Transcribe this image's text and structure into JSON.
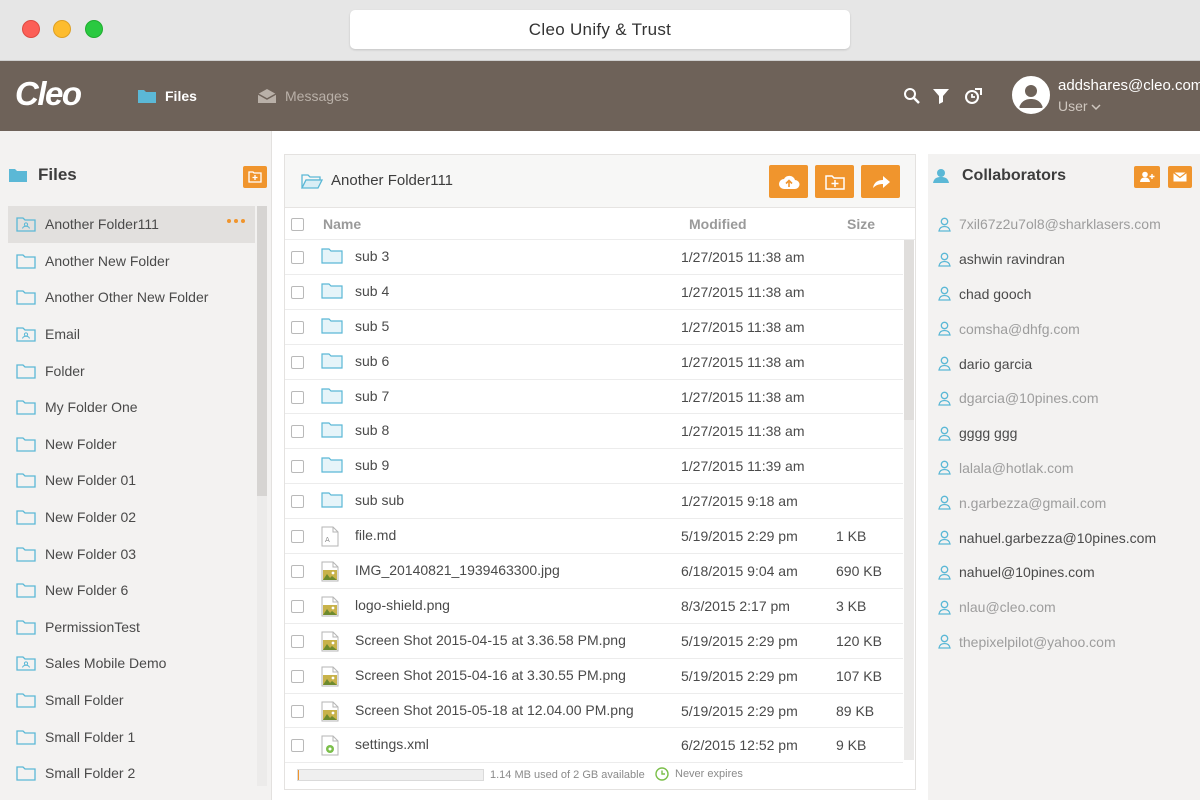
{
  "window": {
    "title": "Cleo Unify & Trust"
  },
  "header": {
    "logo": "Cleo",
    "nav": {
      "files": "Files",
      "messages": "Messages"
    },
    "user": {
      "email": "addshares@cleo.com",
      "role": "User"
    }
  },
  "sidebar": {
    "title": "Files",
    "folders": [
      {
        "label": "Another Folder111",
        "active": true,
        "shared": true
      },
      {
        "label": "Another New Folder"
      },
      {
        "label": "Another Other New Folder"
      },
      {
        "label": "Email",
        "shared": true
      },
      {
        "label": "Folder"
      },
      {
        "label": "My Folder One"
      },
      {
        "label": "New Folder"
      },
      {
        "label": "New Folder 01"
      },
      {
        "label": "New Folder 02"
      },
      {
        "label": "New Folder 03"
      },
      {
        "label": "New Folder 6"
      },
      {
        "label": "PermissionTest"
      },
      {
        "label": "Sales Mobile Demo",
        "shared": true
      },
      {
        "label": "Small Folder"
      },
      {
        "label": "Small Folder 1"
      },
      {
        "label": "Small Folder 2"
      }
    ]
  },
  "main": {
    "breadcrumb": "Another Folder111",
    "columns": {
      "name": "Name",
      "modified": "Modified",
      "size": "Size"
    },
    "files": [
      {
        "name": "sub 3",
        "modified": "1/27/2015 11:38 am",
        "size": "",
        "type": "folder"
      },
      {
        "name": "sub 4",
        "modified": "1/27/2015 11:38 am",
        "size": "",
        "type": "folder"
      },
      {
        "name": "sub 5",
        "modified": "1/27/2015 11:38 am",
        "size": "",
        "type": "folder"
      },
      {
        "name": "sub 6",
        "modified": "1/27/2015 11:38 am",
        "size": "",
        "type": "folder"
      },
      {
        "name": "sub 7",
        "modified": "1/27/2015 11:38 am",
        "size": "",
        "type": "folder"
      },
      {
        "name": "sub 8",
        "modified": "1/27/2015 11:38 am",
        "size": "",
        "type": "folder"
      },
      {
        "name": "sub 9",
        "modified": "1/27/2015 11:39 am",
        "size": "",
        "type": "folder"
      },
      {
        "name": "sub sub",
        "modified": "1/27/2015 9:18 am",
        "size": "",
        "type": "folder"
      },
      {
        "name": "file.md",
        "modified": "5/19/2015 2:29 pm",
        "size": "1 KB",
        "type": "doc"
      },
      {
        "name": "IMG_20140821_1939463300.jpg",
        "modified": "6/18/2015 9:04 am",
        "size": "690 KB",
        "type": "image"
      },
      {
        "name": "logo-shield.png",
        "modified": "8/3/2015 2:17 pm",
        "size": "3 KB",
        "type": "image"
      },
      {
        "name": "Screen Shot 2015-04-15 at 3.36.58 PM.png",
        "modified": "5/19/2015 2:29 pm",
        "size": "120 KB",
        "type": "image"
      },
      {
        "name": "Screen Shot 2015-04-16 at 3.30.55 PM.png",
        "modified": "5/19/2015 2:29 pm",
        "size": "107 KB",
        "type": "image"
      },
      {
        "name": "Screen Shot 2015-05-18 at 12.04.00 PM.png",
        "modified": "5/19/2015 2:29 pm",
        "size": "89 KB",
        "type": "image"
      },
      {
        "name": "settings.xml",
        "modified": "6/2/2015 12:52 pm",
        "size": "9 KB",
        "type": "xml"
      }
    ],
    "footer": {
      "usage": "1.14 MB used of 2 GB available",
      "usage_fraction": 0.0006,
      "expiry": "Never expires"
    }
  },
  "collaborators": {
    "title": "Collaborators",
    "list": [
      {
        "label": "7xil67z2u7ol8@sharklasers.com",
        "status": "pending"
      },
      {
        "label": "ashwin ravindran",
        "status": "joined"
      },
      {
        "label": "chad gooch",
        "status": "joined"
      },
      {
        "label": "comsha@dhfg.com",
        "status": "pending"
      },
      {
        "label": "dario garcia",
        "status": "joined"
      },
      {
        "label": "dgarcia@10pines.com",
        "status": "pending"
      },
      {
        "label": "gggg ggg",
        "status": "joined"
      },
      {
        "label": "lalala@hotlak.com",
        "status": "pending"
      },
      {
        "label": "n.garbezza@gmail.com",
        "status": "pending"
      },
      {
        "label": "nahuel.garbezza@10pines.com",
        "status": "joined"
      },
      {
        "label": "nahuel@10pines.com",
        "status": "joined"
      },
      {
        "label": "nlau@cleo.com",
        "status": "pending"
      },
      {
        "label": "thepixelpilot@yahoo.com",
        "status": "pending"
      }
    ]
  },
  "colors": {
    "accent": "#f0952d",
    "header_bg": "#6e6259",
    "folder_icon": "#5bb8d6"
  }
}
